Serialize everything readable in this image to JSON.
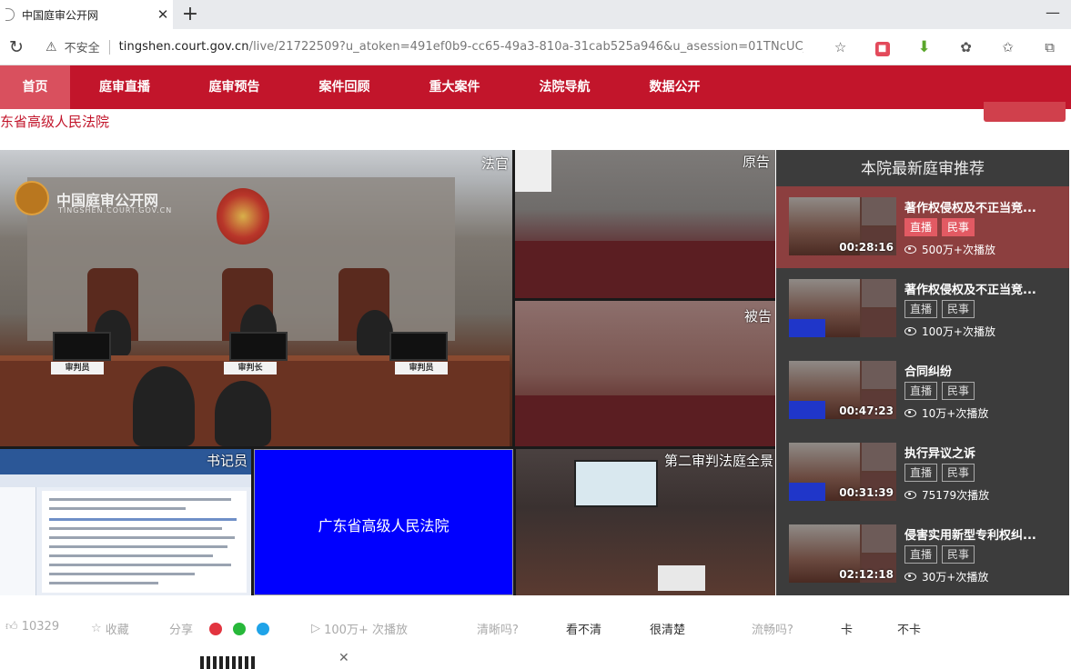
{
  "browser": {
    "tab_title": "中国庭审公开网",
    "tab_close": "✕",
    "new_tab": "+",
    "window_min": "—",
    "insecure_label": "不安全",
    "url_host": "tingshen.court.gov.cn",
    "url_path": "/live/21722509?u_atoken=491ef0b9-cc65-49a3-810a-31cab525a946&u_asession=01TNcUC_elHZ..."
  },
  "nav": {
    "items": [
      {
        "label": "首页",
        "active": true
      },
      {
        "label": "庭审直播"
      },
      {
        "label": "庭审预告"
      },
      {
        "label": "案件回顾"
      },
      {
        "label": "重大案件"
      },
      {
        "label": "法院导航"
      },
      {
        "label": "数据公开"
      }
    ]
  },
  "court_title": "东省高级人民法院",
  "player": {
    "labels": {
      "main": "法官",
      "plaintiff": "原告",
      "defendant": "被告",
      "clerk": "书记员",
      "wide": "第二审判法庭全景"
    },
    "center_text": "广东省高级人民法院",
    "watermark": "中国庭审公开网",
    "watermark_sub": "TINGSHEN.COURT.GOV.CN",
    "plates": [
      "审判员",
      "审判长",
      "审判员"
    ]
  },
  "sidebar": {
    "heading": "本院最新庭审推荐",
    "items": [
      {
        "title": "著作权侵权及不正当竞...",
        "tags": [
          "直播",
          "民事"
        ],
        "duration": "00:28:16",
        "views": "500万+次播放",
        "active": true
      },
      {
        "title": "著作权侵权及不正当竞...",
        "tags": [
          "直播",
          "民事"
        ],
        "duration": "",
        "views": "100万+次播放"
      },
      {
        "title": "合同纠纷",
        "tags": [
          "直播",
          "民事"
        ],
        "duration": "00:47:23",
        "views": "10万+次播放"
      },
      {
        "title": "执行异议之诉",
        "tags": [
          "直播",
          "民事"
        ],
        "duration": "00:31:39",
        "views": "75179次播放"
      },
      {
        "title": "侵害实用新型专利权纠...",
        "tags": [
          "直播",
          "民事"
        ],
        "duration": "02:12:18",
        "views": "30万+次播放"
      }
    ]
  },
  "bottom": {
    "likes": "10329",
    "favorite": "收藏",
    "share": "分享",
    "plays": "100万+ 次播放",
    "clarity_q": "清晰吗?",
    "clarity_no": "看不清",
    "clarity_yes": "很清楚",
    "smooth_q": "流畅吗?",
    "smooth_no": "卡",
    "smooth_yes": "不卡"
  },
  "colors": {
    "brand_red": "#c2152b",
    "sidebar_bg": "#3c3c3c",
    "active_item": "#8c3f3f"
  }
}
